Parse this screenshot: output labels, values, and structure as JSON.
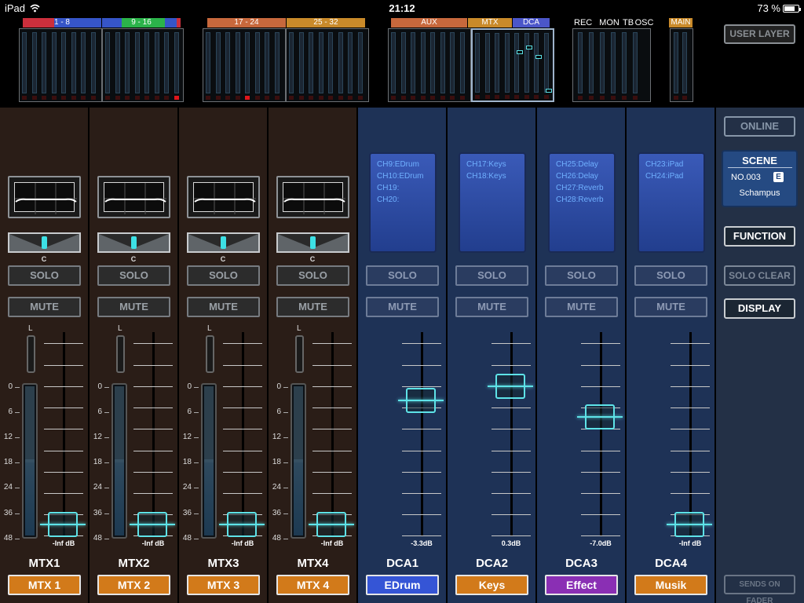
{
  "status": {
    "device": "iPad",
    "time": "21:12",
    "battery": "73 %"
  },
  "overview": {
    "groups": [
      {
        "label": "1 - 8",
        "color": "#cc2f3c"
      },
      {
        "label": "9 - 16",
        "color": "#2bb34a"
      },
      {
        "label": "17 - 24",
        "color": "#c7683c"
      },
      {
        "label": "25 - 32",
        "color": "#c98a2a"
      },
      {
        "label": "AUX",
        "color": "#c7683c"
      },
      {
        "label": "MTX",
        "color": "#c98a2a"
      },
      {
        "label": "DCA",
        "color": "#4b56c9"
      },
      {
        "label": "REC",
        "color": ""
      },
      {
        "label": "MON",
        "color": ""
      },
      {
        "label": "TB",
        "color": ""
      },
      {
        "label": "OSC",
        "color": ""
      },
      {
        "label": "MAIN",
        "color": "#c98a2a"
      }
    ],
    "user_layer": "USER LAYER"
  },
  "buttons": {
    "solo": "SOLO",
    "mute": "MUTE",
    "center": "C",
    "left": "L"
  },
  "scale": [
    "0",
    "6",
    "12",
    "18",
    "24",
    "36",
    "48"
  ],
  "mtx_strips": [
    {
      "name": "MTX1",
      "label": "MTX 1",
      "label_color": "#d27a1a",
      "value": "-Inf dB",
      "meter_level": 0.5
    },
    {
      "name": "MTX2",
      "label": "MTX 2",
      "label_color": "#d27a1a",
      "value": "-Inf dB",
      "meter_level": 0.5
    },
    {
      "name": "MTX3",
      "label": "MTX 3",
      "label_color": "#d27a1a",
      "value": "-Inf dB",
      "meter_level": 0.5
    },
    {
      "name": "MTX4",
      "label": "MTX 4",
      "label_color": "#d27a1a",
      "value": "-Inf dB",
      "meter_level": 0.5
    }
  ],
  "dca_strips": [
    {
      "name": "DCA1",
      "label": "EDrum",
      "label_color": "#3555d6",
      "value": "-3.3dB",
      "assigned": [
        "CH9:EDrum",
        "CH10:EDrum",
        "CH19:",
        "CH20:"
      ]
    },
    {
      "name": "DCA2",
      "label": "Keys",
      "label_color": "#d27a1a",
      "value": "0.3dB",
      "assigned": [
        "CH17:Keys",
        "CH18:Keys"
      ]
    },
    {
      "name": "DCA3",
      "label": "Effect",
      "label_color": "#8a2fb4",
      "value": "-7.0dB",
      "assigned": [
        "CH25:Delay",
        "CH26:Delay",
        "CH27:Reverb",
        "CH28:Reverb"
      ]
    },
    {
      "name": "DCA4",
      "label": "Musik",
      "label_color": "#d27a1a",
      "value": "-Inf dB",
      "assigned": [
        "CH23:iPad",
        "CH24:iPad"
      ]
    }
  ],
  "right_panel": {
    "online": "ONLINE",
    "scene_title": "SCENE",
    "scene_no": "NO.003",
    "scene_badge": "E",
    "scene_name": "Schampus",
    "function": "FUNCTION",
    "solo_clear": "SOLO CLEAR",
    "display": "DISPLAY",
    "sends_on_fader": "SENDS ON FADER"
  }
}
